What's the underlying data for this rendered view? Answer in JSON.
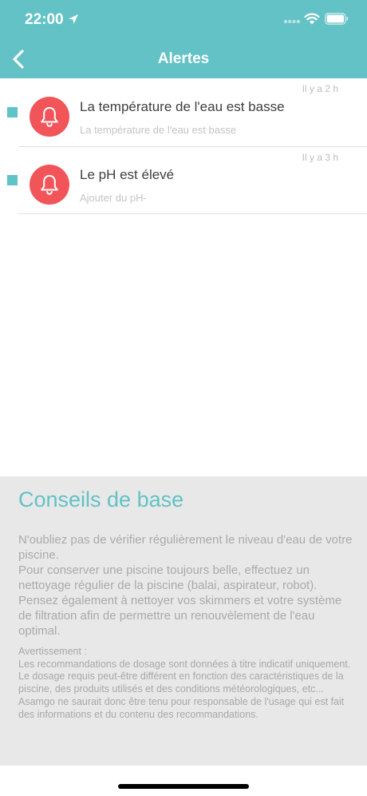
{
  "status_bar": {
    "time": "22:00"
  },
  "nav": {
    "title": "Alertes",
    "back_icon": "chevron-left-icon"
  },
  "colors": {
    "header_bg": "#62c2c6",
    "alert_icon_bg": "#f1555a",
    "unread_marker": "#5fc3c8",
    "tips_bg": "#e8e8e8",
    "tips_title": "#62c2c6"
  },
  "alerts": [
    {
      "time": "Il y a 2 h",
      "title": "La température de l'eau est basse",
      "subtitle": "La température de l'eau est basse",
      "icon": "bell-icon",
      "unread": true
    },
    {
      "time": "Il y a 3 h",
      "title": "Le pH est élevé",
      "subtitle": "Ajouter du pH-",
      "icon": "bell-icon",
      "unread": true
    }
  ],
  "tips": {
    "title": "Conseils de base",
    "paragraph_1": "N'oubliez pas de vérifier régulièrement le niveau d'eau de votre piscine.",
    "paragraph_2": "Pour conserver une piscine toujours belle, effectuez un nettoyage régulier de la piscine (balai, aspirateur, robot).",
    "paragraph_3": "Pensez également à nettoyer vos skimmers et votre système de filtration afin de permettre un renouvèlement de l'eau optimal.",
    "warning_heading": "Avertissement :",
    "warning_1": "Les recommandations de dosage sont données à titre indicatif uniquement.",
    "warning_2": "Le dosage requis peut-être différent en fonction des caractéristiques de la piscine, des produits utilisés et des conditions météorologiques, etc...",
    "warning_3": "Asamgo ne saurait donc être tenu pour responsable de l'usage qui est fait des informations et du contenu des recommandations."
  }
}
